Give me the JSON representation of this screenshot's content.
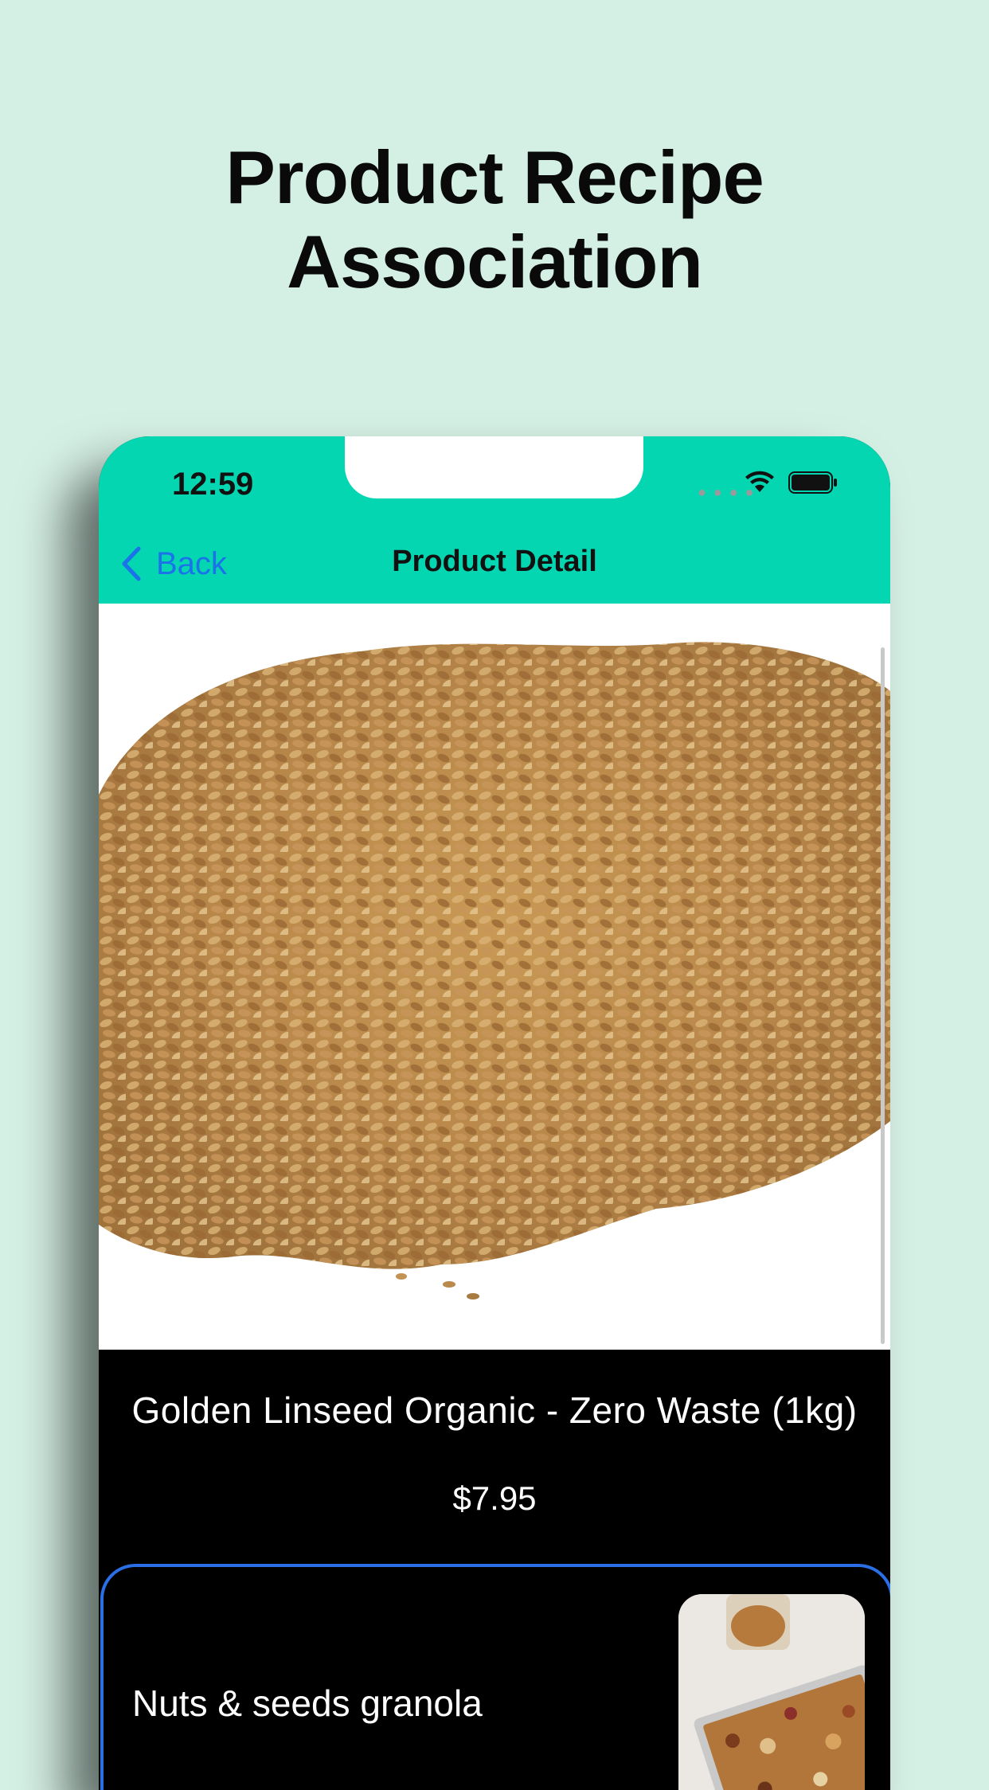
{
  "headline": {
    "line1": "Product Recipe",
    "line2": "Association"
  },
  "status_bar": {
    "time": "12:59"
  },
  "navbar": {
    "back_label": "Back",
    "title": "Product Detail"
  },
  "product": {
    "name": "Golden Linseed Organic - Zero Waste (1kg)",
    "price": "$7.95"
  },
  "recipe": {
    "title": "Nuts & seeds granola"
  },
  "colors": {
    "accent": "#04d6b2",
    "link": "#1a73e8",
    "card_border": "#2a6fe6",
    "background": "#d4efe4"
  },
  "icons": [
    "chevron-left-icon",
    "wifi-icon",
    "battery-icon"
  ]
}
